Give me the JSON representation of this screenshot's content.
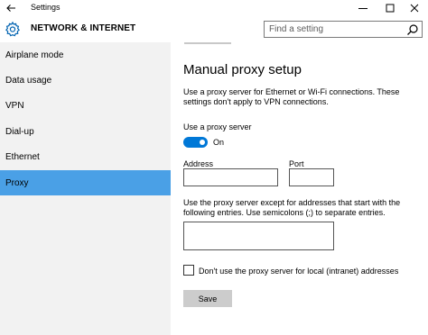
{
  "window": {
    "title": "Settings",
    "back_icon": "back-arrow-icon",
    "minimize_icon": "minimize-icon",
    "maximize_icon": "maximize-icon",
    "close_icon": "close-icon"
  },
  "header": {
    "icon": "gear-icon",
    "title": "NETWORK & INTERNET",
    "search_placeholder": "Find a setting",
    "search_icon": "search-icon"
  },
  "sidebar": {
    "items": [
      {
        "label": "Airplane mode"
      },
      {
        "label": "Data usage"
      },
      {
        "label": "VPN"
      },
      {
        "label": "Dial-up"
      },
      {
        "label": "Ethernet"
      },
      {
        "label": "Proxy",
        "selected": true
      }
    ],
    "selected_color": "#4aa0e6"
  },
  "main": {
    "title": "Manual proxy setup",
    "description": "Use a proxy server for Ethernet or Wi-Fi connections. These settings don't apply to VPN connections.",
    "use_proxy_label": "Use a proxy server",
    "toggle_state": "On",
    "toggle_color": "#0078d7",
    "address_label": "Address",
    "address_value": "",
    "port_label": "Port",
    "port_value": "",
    "exceptions_description": "Use the proxy server except for addresses that start with the following entries. Use semicolons (;) to separate entries.",
    "exceptions_value": "",
    "local_checkbox_label": "Don't use the proxy server for local (intranet) addresses",
    "local_checkbox_checked": false,
    "save_label": "Save"
  }
}
